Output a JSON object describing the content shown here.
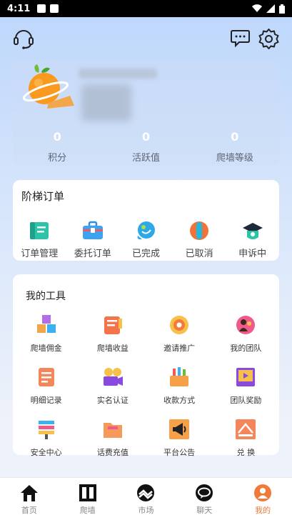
{
  "status": {
    "time": "4:11"
  },
  "header": {
    "support_icon": "headset-icon",
    "message_icon": "message-icon",
    "settings_icon": "gear-icon"
  },
  "profile": {
    "avatar": "orange-planet-avatar",
    "stats": [
      {
        "value": "0",
        "label": "积分"
      },
      {
        "value": "0",
        "label": "活跃值"
      },
      {
        "value": "0",
        "label": "爬墙等级"
      }
    ]
  },
  "orders": {
    "title": "阶梯订单",
    "items": [
      {
        "label": "订单管理",
        "icon": "order-book-icon"
      },
      {
        "label": "委托订单",
        "icon": "briefcase-icon"
      },
      {
        "label": "已完成",
        "icon": "completed-bubble-icon"
      },
      {
        "label": "已取消",
        "icon": "cancel-capsule-icon"
      },
      {
        "label": "申诉中",
        "icon": "appeal-hat-icon"
      }
    ]
  },
  "tools": {
    "title": "我的工具",
    "items": [
      {
        "label": "爬墙佣金",
        "icon": "cubes-icon"
      },
      {
        "label": "爬墙收益",
        "icon": "notebook-icon"
      },
      {
        "label": "邀请推广",
        "icon": "gear-badge-icon"
      },
      {
        "label": "我的团队",
        "icon": "team-icon"
      },
      {
        "label": "明细记录",
        "icon": "record-icon"
      },
      {
        "label": "实名认证",
        "icon": "camera-icon"
      },
      {
        "label": "收款方式",
        "icon": "payment-box-icon"
      },
      {
        "label": "团队奖励",
        "icon": "video-frame-icon"
      },
      {
        "label": "安全中心",
        "icon": "security-icon"
      },
      {
        "label": "话费充值",
        "icon": "folder-icon"
      },
      {
        "label": "平台公告",
        "icon": "megaphone-icon"
      },
      {
        "label": "兑 换",
        "icon": "exchange-icon"
      }
    ]
  },
  "tabbar": {
    "items": [
      {
        "label": "首页",
        "icon": "home-icon"
      },
      {
        "label": "爬墙",
        "icon": "wall-icon"
      },
      {
        "label": "市场",
        "icon": "market-icon"
      },
      {
        "label": "聊天",
        "icon": "chat-icon"
      },
      {
        "label": "我的",
        "icon": "profile-icon",
        "active": true
      }
    ]
  },
  "colors": {
    "accent": "#f07a3a",
    "background_top": "#bcd6fb",
    "card": "#ffffff"
  }
}
